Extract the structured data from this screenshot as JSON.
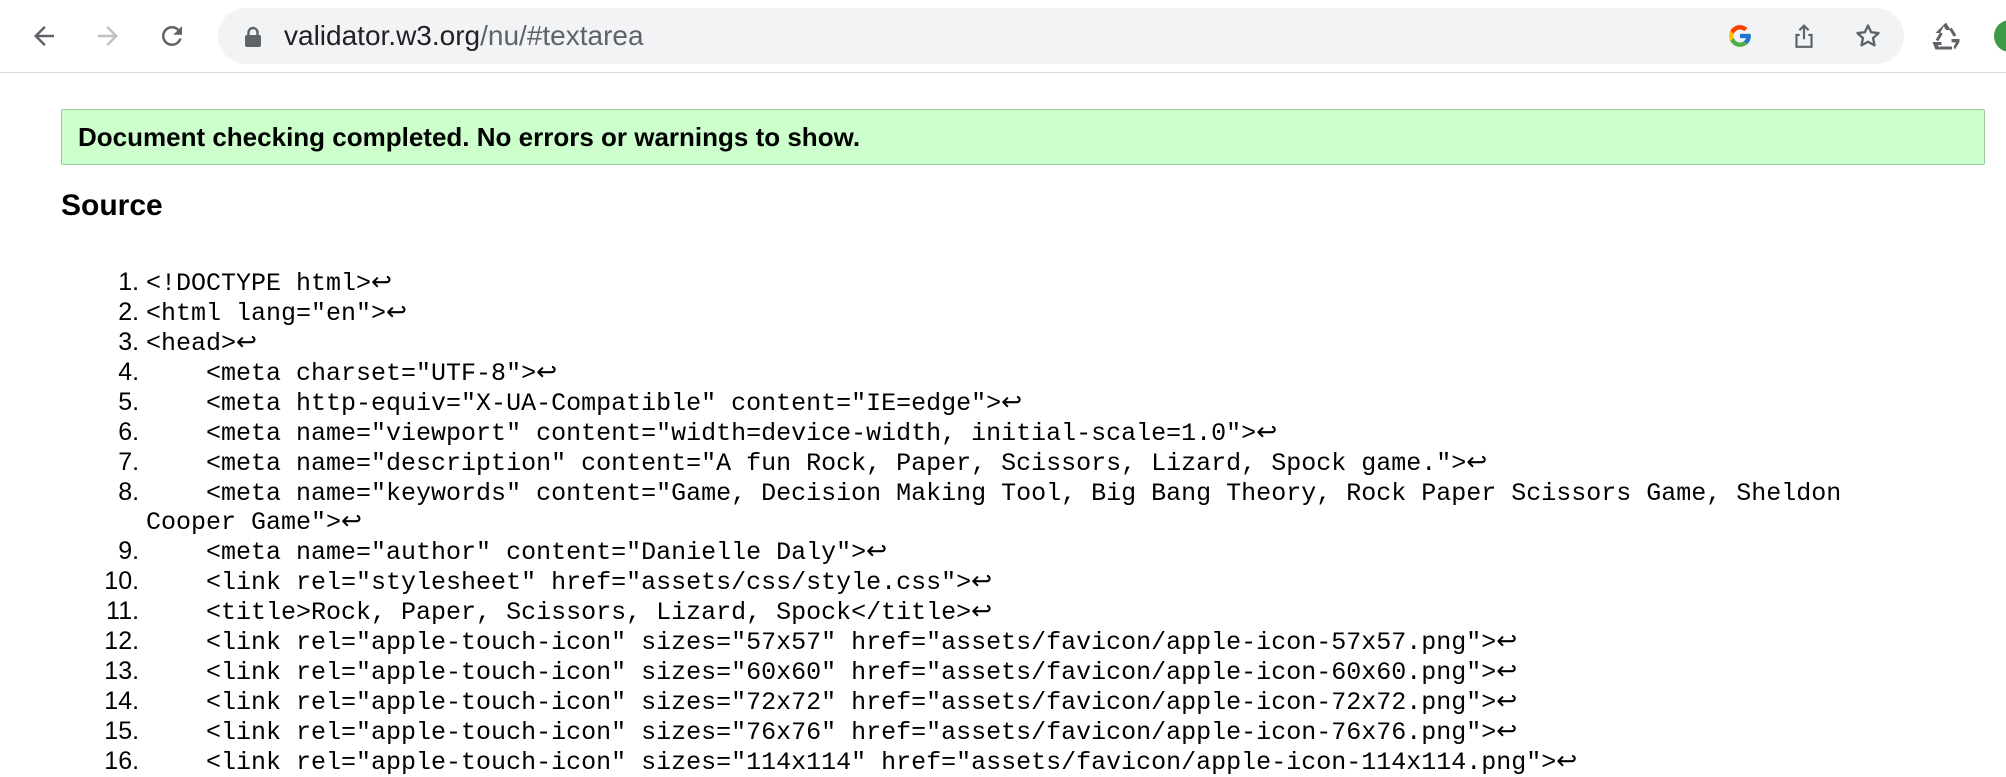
{
  "browser": {
    "url_host": "validator.w3.org",
    "url_path": "/nu/#textarea",
    "icons": [
      "back-icon",
      "forward-icon",
      "reload-icon",
      "lock-icon",
      "google-icon",
      "share-icon",
      "bookmark-star-icon",
      "extension-recycle-icon",
      "profile-avatar"
    ]
  },
  "validator": {
    "result_message": "Document checking completed. No errors or warnings to show.",
    "source_heading": "Source",
    "line_end_glyph": "↩",
    "lines": [
      "<!DOCTYPE html>",
      "<html lang=\"en\">",
      "<head>",
      "    <meta charset=\"UTF-8\">",
      "    <meta http-equiv=\"X-UA-Compatible\" content=\"IE=edge\">",
      "    <meta name=\"viewport\" content=\"width=device-width, initial-scale=1.0\">",
      "    <meta name=\"description\" content=\"A fun Rock, Paper, Scissors, Lizard, Spock game.\">",
      "    <meta name=\"keywords\" content=\"Game, Decision Making Tool, Big Bang Theory, Rock Paper Scissors Game, Sheldon Cooper Game\">",
      "    <meta name=\"author\" content=\"Danielle Daly\">",
      "    <link rel=\"stylesheet\" href=\"assets/css/style.css\">",
      "    <title>Rock, Paper, Scissors, Lizard, Spock</title>",
      "    <link rel=\"apple-touch-icon\" sizes=\"57x57\" href=\"assets/favicon/apple-icon-57x57.png\">",
      "    <link rel=\"apple-touch-icon\" sizes=\"60x60\" href=\"assets/favicon/apple-icon-60x60.png\">",
      "    <link rel=\"apple-touch-icon\" sizes=\"72x72\" href=\"assets/favicon/apple-icon-72x72.png\">",
      "    <link rel=\"apple-touch-icon\" sizes=\"76x76\" href=\"assets/favicon/apple-icon-76x76.png\">",
      "    <link rel=\"apple-touch-icon\" sizes=\"114x114\" href=\"assets/favicon/apple-icon-114x114.png\">"
    ]
  },
  "colors": {
    "success_bg": "#ccffcc",
    "success_border": "#99cc99",
    "omnibox_bg": "#f1f3f4"
  }
}
